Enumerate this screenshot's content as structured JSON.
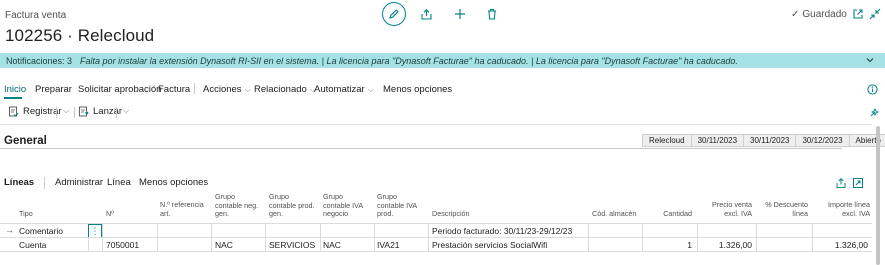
{
  "header": {
    "doc_type": "Factura venta",
    "title": "102256 · Relecloud",
    "saved_label": "Guardado"
  },
  "notification": {
    "count_label": "Notificaciones: 3",
    "message": "Falta por instalar la extensión Dynasoft RI-SII en el sistema. | La licencia para \"Dynasoft Facturae\" ha caducado. | La licencia para \"Dynasoft Facturae\" ha caducado."
  },
  "actions": {
    "inicio": "Inicio",
    "preparar": "Preparar",
    "solicitar": "Solicitar aprobación",
    "factura": "Factura",
    "acciones": "Acciones",
    "relacionado": "Relacionado",
    "automatizar": "Automatizar",
    "menos": "Menos opciones"
  },
  "subactions": {
    "registrar": "Registrar",
    "lanzar": "Lanzar"
  },
  "general": {
    "title": "General",
    "tags": [
      "Relecloud",
      "30/11/2023",
      "30/11/2023",
      "30/12/2023",
      "Abierto"
    ]
  },
  "lines": {
    "title": "Líneas",
    "administrar": "Administrar",
    "linea": "Línea",
    "menos": "Menos opciones"
  },
  "table": {
    "headers": {
      "tipo": "Tipo",
      "no": "Nº",
      "ref": [
        "N.º referencia",
        "art."
      ],
      "gcng": [
        "Grupo",
        "contable neg.",
        "gen."
      ],
      "gcpg": [
        "Grupo",
        "contable prod.",
        "gen."
      ],
      "gcivan": [
        "Grupo",
        "contable IVA",
        "negocio"
      ],
      "gcivap": [
        "Grupo",
        "contable IVA",
        "prod."
      ],
      "desc": "Descripción",
      "almacen": "Cód. almacén",
      "cantidad": "Cantidad",
      "precio": [
        "Precio venta",
        "excl. IVA"
      ],
      "descuento": [
        "% Descuento",
        "línea"
      ],
      "importe": [
        "Importe línea",
        "excl. IVA"
      ]
    },
    "rows": [
      {
        "tipo": "Comentario",
        "no": "",
        "gcng": "",
        "gcpg": "",
        "gcivan": "",
        "gcivap": "",
        "desc": "Periodo facturado: 30/11/23-29/12/23",
        "cantidad": "",
        "precio": "",
        "importe": ""
      },
      {
        "tipo": "Cuenta",
        "no": "7050001",
        "gcng": "NAC",
        "gcpg": "SERVICIOS",
        "gcivan": "NAC",
        "gcivap": "IVA21",
        "desc": "Prestación servicios SocialWifi",
        "cantidad": "1",
        "precio": "1.326,00",
        "importe": "1.326,00"
      }
    ]
  },
  "colors": {
    "accent": "#008489",
    "notification_bg": "#a5e2e5"
  }
}
